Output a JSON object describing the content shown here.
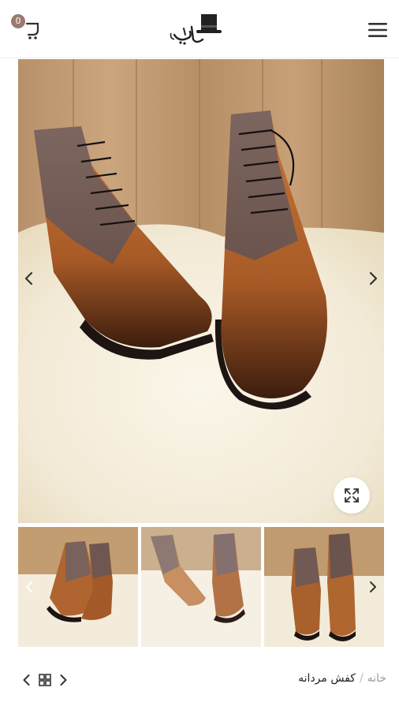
{
  "header": {
    "cart_count": "0",
    "logo_icon": "top-hat-logo",
    "menu_icon": "hamburger-icon"
  },
  "gallery": {
    "thumbnails_count_visible": 3
  },
  "breadcrumb": {
    "home": "خانه",
    "separator": "/",
    "current": "کفش مردانه"
  },
  "colors": {
    "accent": "#9b7a6e",
    "text": "#222222",
    "muted": "#999999"
  }
}
